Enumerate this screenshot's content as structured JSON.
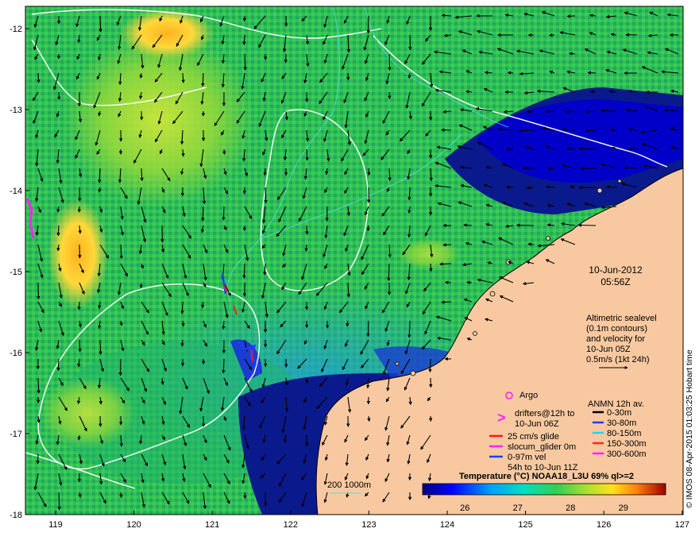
{
  "date_line1": "10-Jun-2012",
  "date_line2": "05:56Z",
  "altimetry_lines": [
    "Altimetric sealevel",
    "(0.1m contours)",
    "and velocity for",
    "10-Jun 05Z",
    "0.5m/s (1kt 24h)"
  ],
  "argo_label": "Argo",
  "drifters_lines": [
    "drifters@12h to",
    "10-Jun 06Z"
  ],
  "glider_lines": [
    "25 cm/s glide",
    "slocum_glider 0m",
    "0-97m vel",
    "54h to 10-Jun 11Z"
  ],
  "anmn_title": "ANMN 12h av.",
  "anmn_items": [
    {
      "label": "0-30m",
      "color": "#000000"
    },
    {
      "label": "30-80m",
      "color": "#1f3cff"
    },
    {
      "label": "80-150m",
      "color": "#22d3ee"
    },
    {
      "label": "150-300m",
      "color": "#ff2a1a"
    },
    {
      "label": "300-600m",
      "color": "#ff22ff"
    }
  ],
  "colorbar": {
    "title": "Temperature (°C) NOAA18_L3U 69% ql>=2",
    "ticks": [
      "26",
      "27",
      "28",
      "29"
    ],
    "range": [
      25.2,
      29.8
    ]
  },
  "bathy_label": "200  1000m",
  "x_ticks": [
    "119",
    "120",
    "121",
    "122",
    "123",
    "124",
    "125",
    "126",
    "127"
  ],
  "y_ticks": [
    "-12",
    "-13",
    "-14",
    "-15",
    "-16",
    "-17",
    "-18"
  ],
  "credit": "© IMOS 08-Apr-2015 01:03:25 Hobart time",
  "colors": {
    "land": "#f8c9a0",
    "deep_water": "#0a1a8c",
    "sst_mid": "#1eb84a",
    "accent_drifter": "#ff22ff",
    "glider": "#ff1a1a"
  }
}
